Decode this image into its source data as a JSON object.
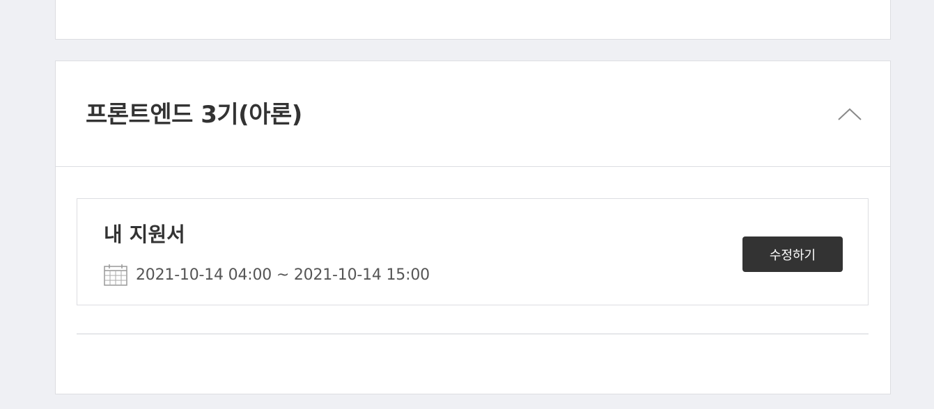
{
  "section": {
    "title": "프론트엔드 3기(아론)",
    "collapse_icon": "chevron-up-icon"
  },
  "application": {
    "title": "내 지원서",
    "period": "2021-10-14 04:00 ~ 2021-10-14 15:00",
    "calendar_icon": "calendar-icon",
    "edit_label": "수정하기"
  },
  "colors": {
    "page_background": "#eff0f4",
    "card_background": "#ffffff",
    "border": "#dcdde1",
    "button_background": "#333333",
    "button_text": "#ffffff",
    "title_text": "#333333",
    "period_text": "#555555"
  }
}
